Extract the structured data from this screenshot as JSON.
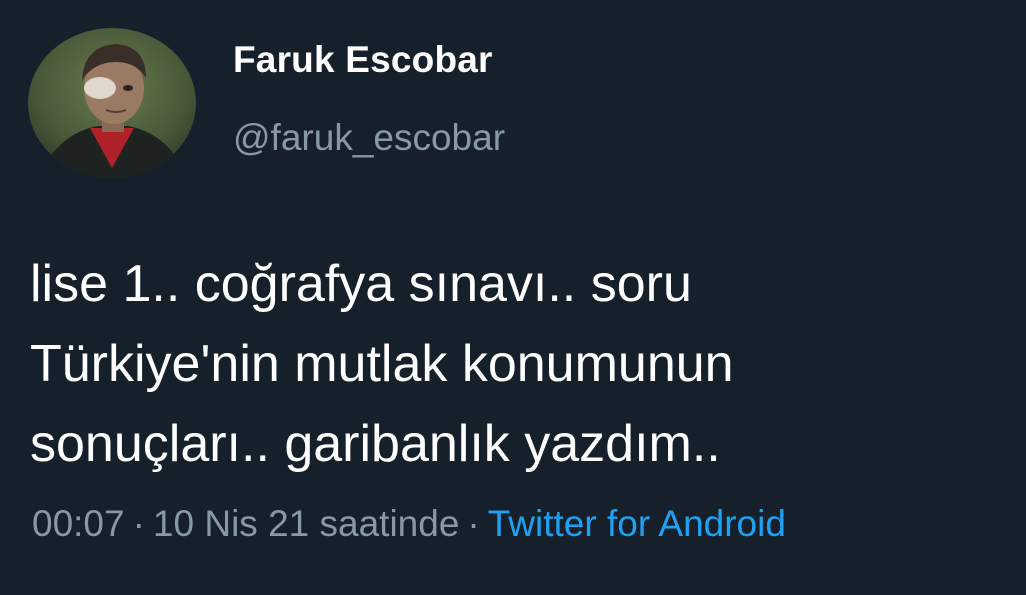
{
  "tweet": {
    "author": {
      "display_name": "Faruk Escobar",
      "handle": "@faruk_escobar"
    },
    "text_lines": [
      "lise 1.. coğrafya sınavı.. soru",
      "Türkiye'nin mutlak konumunun",
      "sonuçları.. garibanlık yazdım.."
    ],
    "meta": {
      "time": "00:07",
      "separator": "·",
      "date": "10 Nis 21 saatinde",
      "source": "Twitter for Android"
    }
  },
  "colors": {
    "background": "#15202b",
    "primary_text": "#ffffff",
    "secondary_text": "#8899a6",
    "link": "#1da1f2"
  }
}
